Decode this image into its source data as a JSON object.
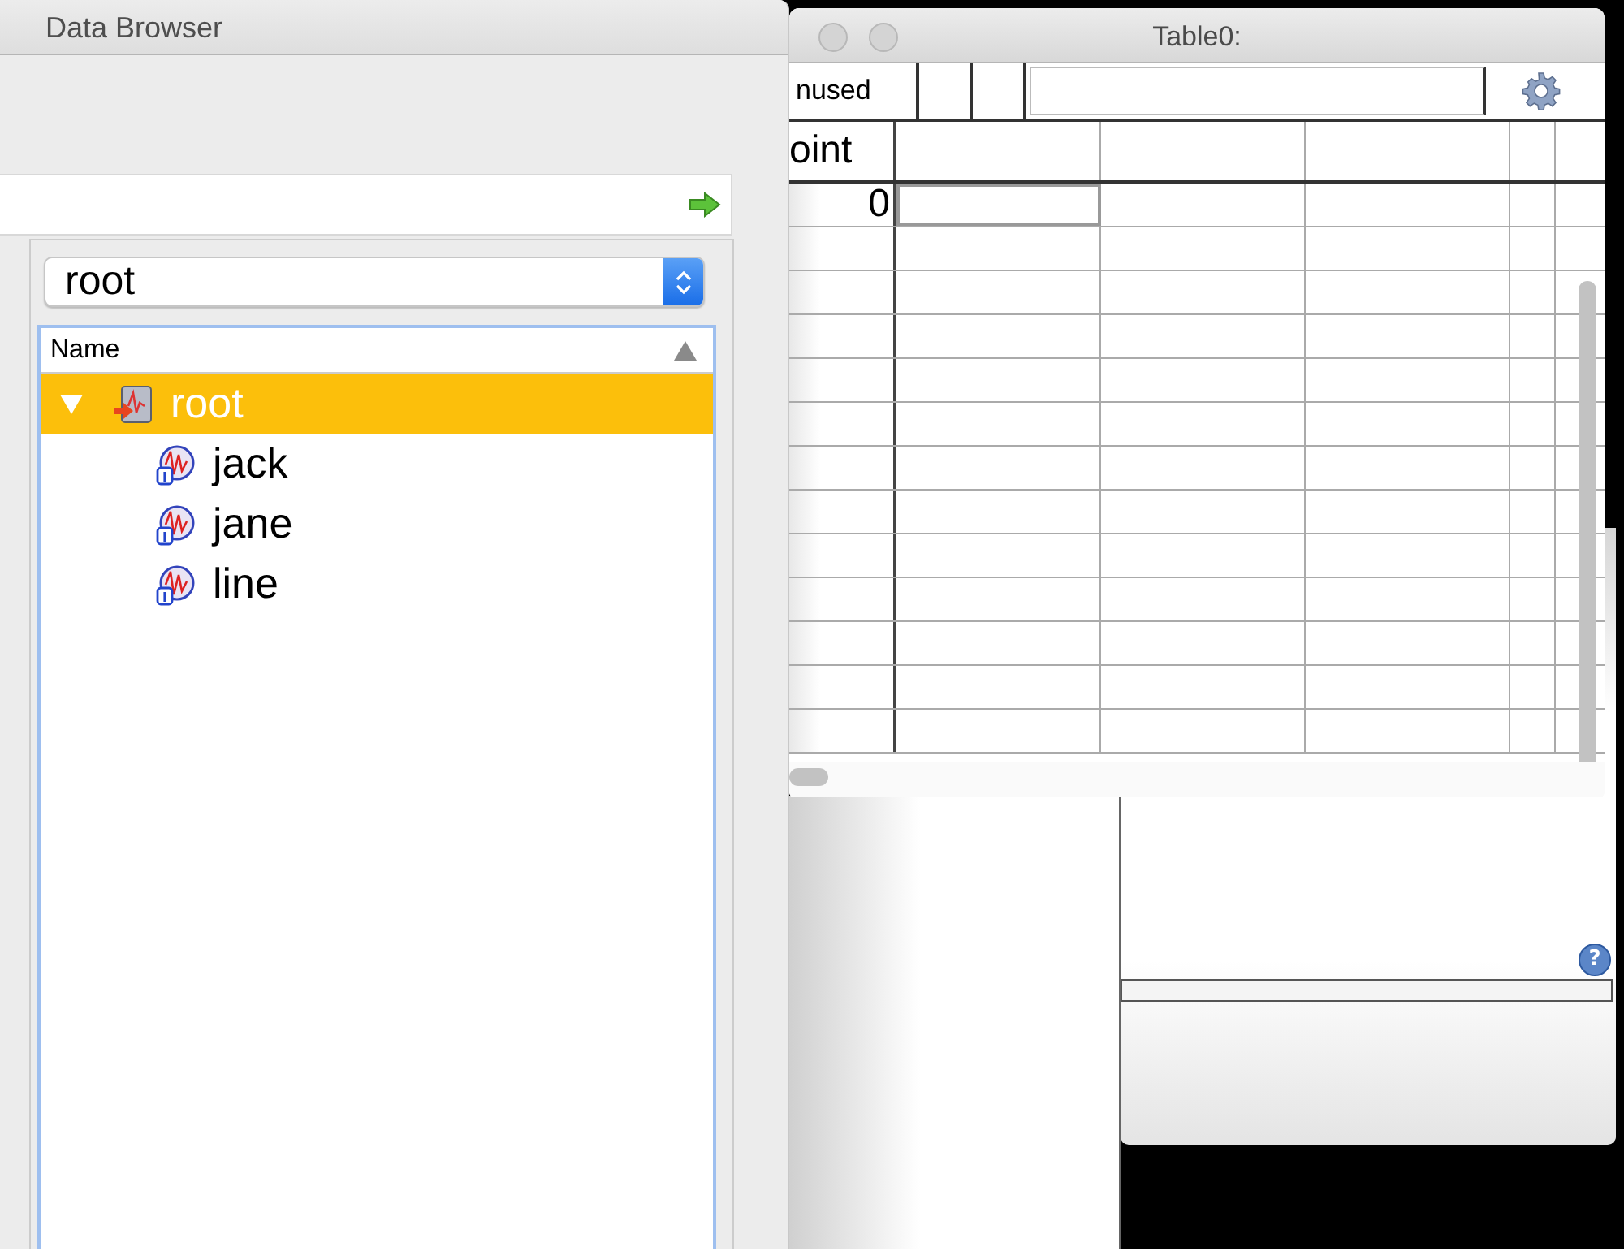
{
  "data_browser": {
    "title": "Data Browser",
    "folder_popup": {
      "value": "root"
    },
    "tree": {
      "column": "Name",
      "items": [
        {
          "name": "root",
          "kind": "folder",
          "expanded": true,
          "selected": true,
          "children": [
            {
              "name": "jack",
              "kind": "wave",
              "selected": false
            },
            {
              "name": "jane",
              "kind": "wave",
              "selected": false
            },
            {
              "name": "line",
              "kind": "wave",
              "selected": false
            }
          ]
        }
      ]
    }
  },
  "table": {
    "title": "Table0:",
    "entry_label": "nused",
    "point_heading": "oint",
    "rows": [
      {
        "point": "0"
      }
    ]
  },
  "help_window": {
    "help_button": "?"
  }
}
